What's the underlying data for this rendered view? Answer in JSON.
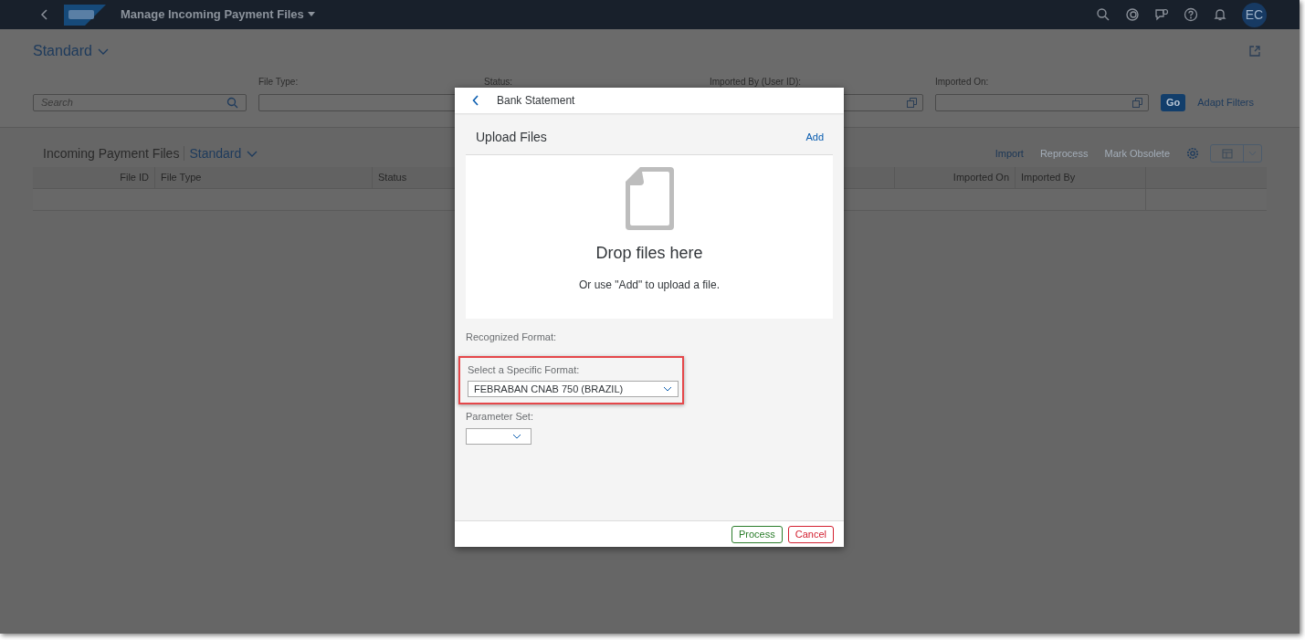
{
  "shell_bar": {
    "title": "Manage Incoming Payment Files",
    "avatar_initials": "EC"
  },
  "page": {
    "variant": "Standard"
  },
  "filter_bar": {
    "search": {
      "placeholder": "Search"
    },
    "filters": [
      {
        "label": "File Type:"
      },
      {
        "label": "Status:"
      },
      {
        "label": "Imported By (User ID):",
        "value_help": true
      },
      {
        "label": "Imported On:",
        "value_help": true
      }
    ],
    "go_button": "Go",
    "adapt_filters": "Adapt Filters"
  },
  "table": {
    "title": "Incoming Payment Files",
    "variant": "Standard",
    "actions": [
      {
        "label": "Import",
        "disabled": false
      },
      {
        "label": "Reprocess",
        "disabled": true
      },
      {
        "label": "Mark Obsolete",
        "disabled": true
      }
    ],
    "columns": [
      "File ID",
      "File Type",
      "Status",
      "Imported On",
      "Imported By"
    ]
  },
  "dialog": {
    "title": "Bank Statement",
    "upload": {
      "title": "Upload Files",
      "add": "Add",
      "drop_title": "Drop files here",
      "drop_hint": "Or use \"Add\" to upload a file."
    },
    "recognized_format": {
      "label": "Recognized Format:"
    },
    "specific_format": {
      "label": "Select a Specific Format:",
      "value": "FEBRABAN CNAB 750 (BRAZIL)",
      "highlighted": true
    },
    "parameter_set": {
      "label": "Parameter Set:"
    },
    "buttons": [
      {
        "label": "Process",
        "kind": "accept"
      },
      {
        "label": "Cancel",
        "kind": "reject"
      }
    ]
  }
}
